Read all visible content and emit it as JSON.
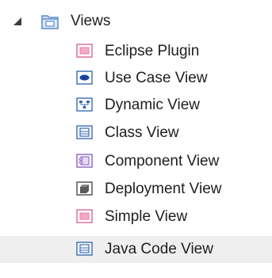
{
  "tree": {
    "root": {
      "label": "Views",
      "icon": "package-folder-icon",
      "expanded": true
    },
    "children": [
      {
        "label": "Eclipse Plugin",
        "icon": "eclipse-plugin-view-icon",
        "selected": false
      },
      {
        "label": "Use Case View",
        "icon": "use-case-view-icon",
        "selected": false
      },
      {
        "label": "Dynamic View",
        "icon": "dynamic-view-icon",
        "selected": false
      },
      {
        "label": "Class View",
        "icon": "class-view-icon",
        "selected": false
      },
      {
        "label": "Component View",
        "icon": "component-view-icon",
        "selected": false
      },
      {
        "label": "Deployment View",
        "icon": "deployment-view-icon",
        "selected": false
      },
      {
        "label": "Simple View",
        "icon": "simple-view-icon",
        "selected": false
      },
      {
        "label": "Java Code View",
        "icon": "java-code-view-icon",
        "selected": true
      }
    ]
  },
  "colors": {
    "selection_background": "#efefef",
    "icon_border_blue": "#3a6bb3",
    "icon_pink": "#f5a9c8",
    "icon_purple": "#9b79c8",
    "package_folder_blue": "#7aa6d8"
  }
}
